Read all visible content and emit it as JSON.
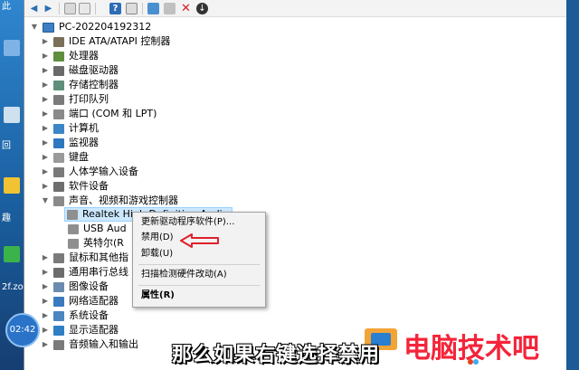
{
  "desktop": {
    "labels": [
      "此",
      "回",
      "趣",
      "2f.zo"
    ]
  },
  "toolbar": {
    "icons": [
      "back-icon",
      "forward-icon",
      "properties-icon",
      "help-icon",
      "update-driver-icon",
      "monitor-icon",
      "add-hardware-icon",
      "uninstall-icon",
      "download-icon"
    ]
  },
  "tree": {
    "root": "PC-202204192312",
    "items": [
      {
        "label": "IDE ATA/ATAPI 控制器",
        "icon": "ide-controller-icon",
        "color": "#7a6f58"
      },
      {
        "label": "处理器",
        "icon": "cpu-icon",
        "color": "#5f8f3e"
      },
      {
        "label": "磁盘驱动器",
        "icon": "disk-icon",
        "color": "#6a6a6a"
      },
      {
        "label": "存储控制器",
        "icon": "storage-controller-icon",
        "color": "#5f8f7a"
      },
      {
        "label": "打印队列",
        "icon": "printer-icon",
        "color": "#7b7b7b"
      },
      {
        "label": "端口 (COM 和 LPT)",
        "icon": "port-icon",
        "color": "#8a8a8a"
      },
      {
        "label": "计算机",
        "icon": "computer-icon",
        "color": "#3b86c7"
      },
      {
        "label": "监视器",
        "icon": "monitor-icon",
        "color": "#2e78c0"
      },
      {
        "label": "键盘",
        "icon": "keyboard-icon",
        "color": "#9a9a9a"
      },
      {
        "label": "人体学输入设备",
        "icon": "hid-icon",
        "color": "#7a7a7a"
      },
      {
        "label": "软件设备",
        "icon": "software-device-icon",
        "color": "#6e6e6e"
      },
      {
        "label": "声音、视频和游戏控制器",
        "icon": "sound-icon",
        "color": "#8a8a8a",
        "expanded": true
      }
    ],
    "children": [
      {
        "label": "Realtek High Definition Audio",
        "icon": "speaker-icon",
        "selected": true
      },
      {
        "label": "USB Aud",
        "icon": "speaker-icon"
      },
      {
        "label": "英特尔(R",
        "icon": "speaker-icon"
      }
    ],
    "items_after": [
      {
        "label": "鼠标和其他指",
        "icon": "mouse-icon",
        "color": "#7a7a7a"
      },
      {
        "label": "通用串行总线",
        "icon": "usb-icon",
        "color": "#6c6c6c"
      },
      {
        "label": "图像设备",
        "icon": "camera-icon",
        "color": "#6b8cb0"
      },
      {
        "label": "网络适配器",
        "icon": "network-adapter-icon",
        "color": "#3a7bbf"
      },
      {
        "label": "系统设备",
        "icon": "system-device-icon",
        "color": "#4c86c0"
      },
      {
        "label": "显示适配器",
        "icon": "display-adapter-icon",
        "color": "#2f7fc5"
      },
      {
        "label": "音频输入和输出",
        "icon": "audio-io-icon",
        "color": "#7a7a7a"
      }
    ]
  },
  "context_menu": {
    "items": [
      "更新驱动程序软件(P)...",
      "禁用(D)",
      "卸载(U)",
      "扫描检测硬件改动(A)",
      "属性(R)"
    ]
  },
  "overlay": {
    "clock": "02:42",
    "subtitle": "那么如果右键选择禁用",
    "brand": "电脑技术吧"
  },
  "colors": {
    "selection": "#cce8ff",
    "annotation": "#e0202c",
    "brand": "#f4243a"
  }
}
